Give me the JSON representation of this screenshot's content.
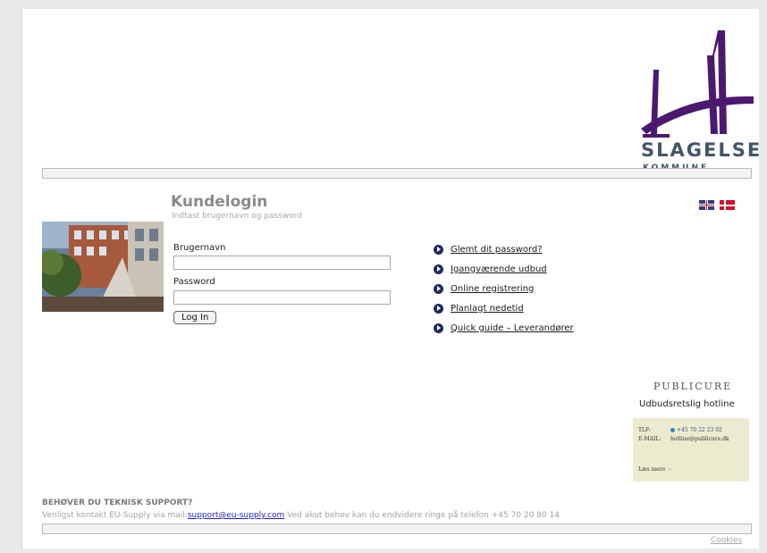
{
  "header": {
    "logo_name": "SLAGELSE",
    "logo_sub": "KOMMUNE",
    "brand_color": "#4b1a6e"
  },
  "login": {
    "title": "Kundelogin",
    "subtitle": "Indtast brugernavn og password",
    "username_label": "Brugernavn",
    "username_value": "",
    "password_label": "Password",
    "password_value": "",
    "button_label": "Log In"
  },
  "languages": [
    "english-flag-icon",
    "danish-flag-icon"
  ],
  "links": [
    {
      "label": "Glemt dit password?",
      "icon": "play-circle-icon"
    },
    {
      "label": "Igangværende udbud",
      "icon": "play-circle-icon"
    },
    {
      "label": "Online registrering",
      "icon": "play-circle-icon"
    },
    {
      "label": "Planlagt nedetid",
      "icon": "play-circle-icon"
    },
    {
      "label": "Quick guide – Leverandører",
      "icon": "play-circle-icon"
    }
  ],
  "publicure": {
    "title": "PUBLICURE",
    "subtitle": "Udbudsretslig hotline",
    "tlf_label": "TLF:",
    "tlf_value": "+45 70 22 23 02",
    "email_label": "E-MAIL:",
    "email_value": "hotline@publicure.dk",
    "more_label": "Læs mere"
  },
  "support": {
    "heading": "BEHØVER DU TEKNISK SUPPORT?",
    "text_before": "Venligst kontakt EU-Supply via mail:",
    "email": "support@eu-supply.com",
    "text_after": " Ved akut behov kan du endvidere ringe på telefon +45 70 20 80 14"
  },
  "footer": {
    "cookies_label": "Cookies"
  }
}
